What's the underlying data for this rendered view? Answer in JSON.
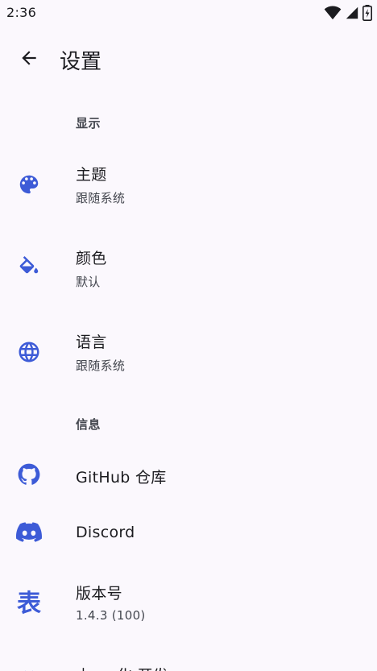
{
  "status_bar": {
    "time": "2:36",
    "icons": [
      "wifi-icon",
      "cell-signal-icon",
      "battery-icon"
    ]
  },
  "app_bar": {
    "back_icon": "arrow-back-icon",
    "title": "设置"
  },
  "colors": {
    "accent": "#3d5bd7",
    "background": "#fbf8fd",
    "text_primary": "#1b1b1f",
    "text_secondary": "#44474f"
  },
  "sections": {
    "display": {
      "header": "显示",
      "theme": {
        "icon": "palette-icon",
        "title": "主题",
        "summary": "跟随系统"
      },
      "color": {
        "icon": "format-color-fill-icon",
        "title": "颜色",
        "summary": "默认"
      },
      "language": {
        "icon": "globe-icon",
        "title": "语言",
        "summary": "跟随系统"
      }
    },
    "info": {
      "header": "信息",
      "github": {
        "icon": "github-icon",
        "title": "GitHub 仓库"
      },
      "discord": {
        "icon": "discord-icon",
        "title": "Discord"
      },
      "version": {
        "icon": "version-glyph-icon",
        "glyph": "表",
        "title": "版本号",
        "summary": "1.4.3 (100)"
      },
      "partial_item": {
        "icon": "partial-icon",
        "title": "由 ... 化 开发"
      }
    }
  }
}
